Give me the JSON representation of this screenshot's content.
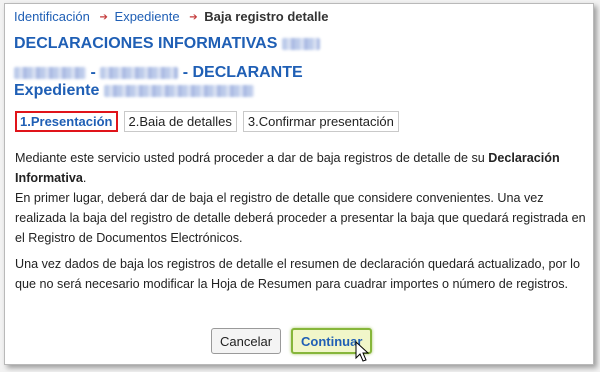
{
  "breadcrumb": {
    "items": [
      "Identificación",
      "Expediente"
    ],
    "current": "Baja registro detalle"
  },
  "header": {
    "title": "DECLARACIONES INFORMATIVAS",
    "declarante_label": "- DECLARANTE",
    "expediente_label": "Expediente"
  },
  "steps": [
    {
      "label": "1.Presentación",
      "active": true
    },
    {
      "label": "2.Baia de detalles",
      "active": false
    },
    {
      "label": "3.Confirmar presentación",
      "active": false
    }
  ],
  "body": {
    "p1_a": "Mediante este servicio usted podrá proceder a dar de baja registros de detalle de su ",
    "p1_bold": "Declaración Informativa",
    "p1_b": ".",
    "p2": "En primer lugar, deberá dar de baja el registro de detalle que considere convenientes. Una vez realizada la baja del registro de detalle deberá proceder a presentar la baja que quedará registrada en el Registro de Documentos Electrónicos.",
    "p3": "Una vez dados de baja los registros de detalle el resumen de declaración quedará actualizado, por lo que no será necesario modificar la Hoja de Resumen para cuadrar importes o número de registros."
  },
  "buttons": {
    "cancel": "Cancelar",
    "continue": "Continuar"
  },
  "colors": {
    "link": "#1f5fb5",
    "active_step_border": "#e0141a",
    "continue_bg": "#f1f6c9",
    "continue_border": "#86b63a"
  }
}
